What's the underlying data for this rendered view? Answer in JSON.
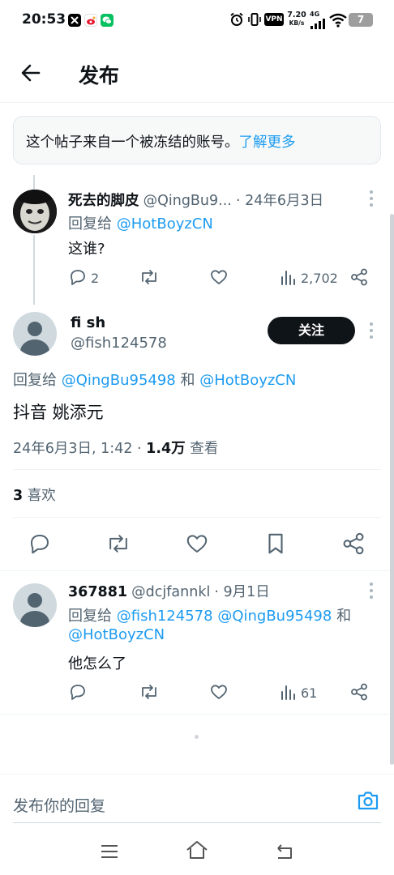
{
  "status_bar": {
    "time": "20:53",
    "vpn": "VPN",
    "speed_value": "7.20",
    "speed_unit": "KB/s",
    "network": "4G",
    "battery": "7"
  },
  "header": {
    "title": "发布"
  },
  "notice": {
    "text": "这个帖子来自一个被冻结的账号。",
    "link": "了解更多"
  },
  "parent_post": {
    "name": "死去的脚皮",
    "handle": "@QingBu9...",
    "date": "· 24年6月3日",
    "reply_prefix": "回复给",
    "reply_to": "@HotBoyzCN",
    "text": "这谁?",
    "replies": "2",
    "views": "2,702"
  },
  "main_post": {
    "name": "fi sh",
    "handle": "@fish124578",
    "follow_label": "关注",
    "reply_prefix": "回复给",
    "reply_to_1": "@QingBu95498",
    "reply_and": "和",
    "reply_to_2": "@HotBoyzCN",
    "text": "抖音 姚添元",
    "datetime": "24年6月3日, 1:42 ·",
    "views_count": "1.4万",
    "views_label": "查看",
    "likes_count": "3",
    "likes_label": "喜欢"
  },
  "reply_post": {
    "name": "367881",
    "handle": "@dcjfannkl",
    "date": "· 9月1日",
    "reply_prefix": "回复给",
    "reply_to_1": "@fish124578",
    "reply_to_2": "@QingBu95498",
    "reply_and": "和",
    "reply_to_3": "@HotBoyzCN",
    "text": "他怎么了",
    "views": "61"
  },
  "reply_bar": {
    "placeholder": "发布你的回复"
  },
  "colors": {
    "accent": "#1d9bf0",
    "text": "#0f1419",
    "secondary": "#536471"
  }
}
